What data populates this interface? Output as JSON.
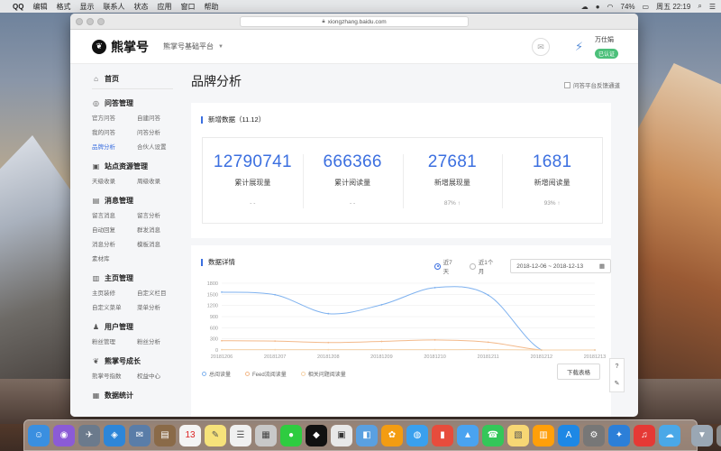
{
  "menubar": {
    "app": "QQ",
    "items": [
      "编辑",
      "格式",
      "显示",
      "联系人",
      "状态",
      "应用",
      "窗口",
      "帮助"
    ],
    "battery": "74%",
    "clock": "周五 22:19"
  },
  "browser": {
    "url": "xiongzhang.baidu.com"
  },
  "header": {
    "logo": "熊掌号",
    "platform": "熊掌号基础平台",
    "user_name": "万仕娟",
    "user_badge": "已认证"
  },
  "sidebar": {
    "home": "首页",
    "sections": [
      {
        "title": "问答管理",
        "items": [
          "官方问答",
          "自建问答",
          "我的问答",
          "问答分析",
          "品牌分析",
          "合伙人设置"
        ],
        "active": 4
      },
      {
        "title": "站点资源管理",
        "items": [
          "天级收录",
          "周级收录"
        ]
      },
      {
        "title": "消息管理",
        "items": [
          "留言消息",
          "留言分析",
          "自动回复",
          "群发消息",
          "消息分析",
          "模板消息",
          "素材库"
        ]
      },
      {
        "title": "主页管理",
        "items": [
          "主页装修",
          "自定义栏目",
          "自定义菜单",
          "菜单分析"
        ]
      },
      {
        "title": "用户管理",
        "items": [
          "粉丝管理",
          "粉丝分析"
        ]
      },
      {
        "title": "熊掌号成长",
        "items": [
          "熊掌号指数",
          "权益中心"
        ]
      },
      {
        "title": "数据统计",
        "items": []
      }
    ]
  },
  "main": {
    "title": "品牌分析",
    "feedback": "问答平台反馈通道",
    "new_data": {
      "title": "新增数据（11.12）",
      "stats": [
        {
          "value": "12790741",
          "label": "累计展现量",
          "sub": "- -"
        },
        {
          "value": "666366",
          "label": "累计阅读量",
          "sub": "- -"
        },
        {
          "value": "27681",
          "label": "新增展现量",
          "sub": "87% ↑"
        },
        {
          "value": "1681",
          "label": "新增阅读量",
          "sub": "93% ↑"
        }
      ]
    },
    "detail": {
      "title": "数据详情",
      "range_7": "近7天",
      "range_30": "近1个月",
      "date_range": "2018-12-06 ~ 2018-12-13",
      "download": "下载表格"
    }
  },
  "chart_data": {
    "type": "line",
    "x": [
      "20181206",
      "20181207",
      "20181208",
      "20181209",
      "20181210",
      "20181211",
      "20181212",
      "20181213"
    ],
    "ylim": [
      0,
      1800
    ],
    "yticks": [
      "1800",
      "1500",
      "1200",
      "900",
      "600",
      "300",
      "0"
    ],
    "series": [
      {
        "name": "总阅读量",
        "color": "#7fb2ef",
        "values": [
          1560,
          1490,
          980,
          1220,
          1680,
          1480,
          0,
          0
        ]
      },
      {
        "name": "Feed流阅读量",
        "color": "#f3b98a",
        "values": [
          250,
          240,
          200,
          230,
          270,
          210,
          0,
          0
        ]
      },
      {
        "name": "相关问题阅读量",
        "color": "#f5d2a8",
        "values": [
          10,
          10,
          10,
          10,
          10,
          10,
          0,
          0
        ]
      }
    ]
  }
}
